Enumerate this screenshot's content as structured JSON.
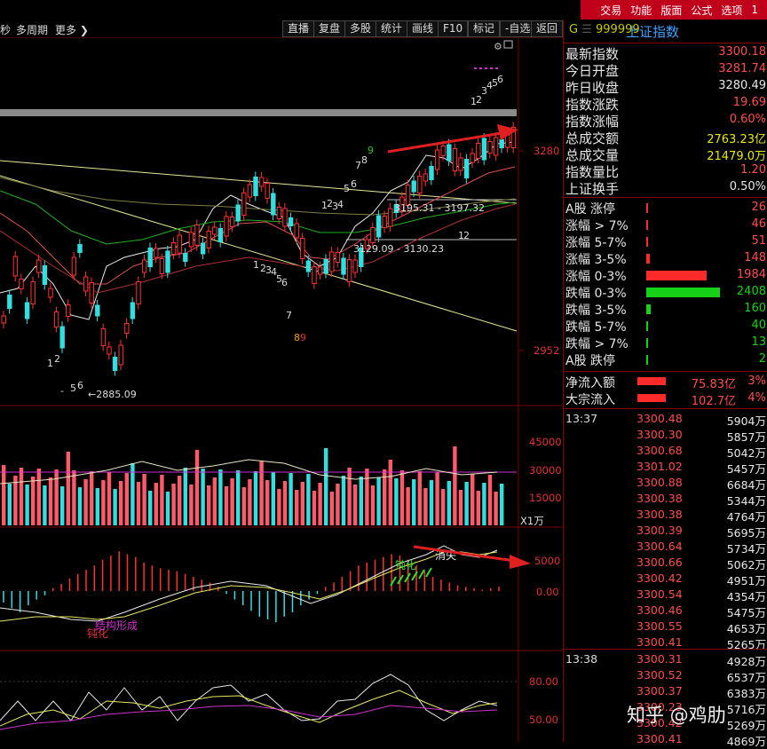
{
  "menu": [
    "交易",
    "功能",
    "版面",
    "公式",
    "选项",
    "1"
  ],
  "toolbar": {
    "left_items": [
      "秒",
      "多周期",
      "更多 ❯"
    ],
    "buttons": [
      "直播",
      "复盘",
      "多股",
      "统计",
      "画线",
      "F10",
      "标记",
      "-自选",
      "返回"
    ]
  },
  "index": {
    "code": "999999",
    "name": "上证指数",
    "prefix": "G"
  },
  "stats": [
    {
      "label": "最新指数",
      "value": "3300.18",
      "color": "#ff4d4d"
    },
    {
      "label": "今日开盘",
      "value": "3281.74",
      "color": "#ff4d4d"
    },
    {
      "label": "昨日收盘",
      "value": "3280.49",
      "color": "#e8e8e8"
    },
    {
      "label": "指数涨跌",
      "value": "19.69",
      "color": "#ff4d4d"
    },
    {
      "label": "指数涨幅",
      "value": "0.60%",
      "color": "#ff4d4d"
    },
    {
      "label": "总成交额",
      "value": "2763.23亿",
      "color": "#e8e800"
    },
    {
      "label": "总成交量",
      "value": "21479.0万",
      "color": "#e8e800"
    },
    {
      "label": "指数量比",
      "value": "1.20",
      "color": "#ff4d4d"
    },
    {
      "label": "上证换手",
      "value": "0.50%",
      "color": "#e8e8e8"
    }
  ],
  "breadth": [
    {
      "label": "A股 涨停",
      "value": "26",
      "bar": 0.005,
      "color": "#ff2a2a"
    },
    {
      "label": "涨幅 > 7%",
      "value": "46",
      "bar": 0.01,
      "color": "#ff2a2a"
    },
    {
      "label": "涨幅 5-7%",
      "value": "51",
      "bar": 0.012,
      "color": "#ff2a2a"
    },
    {
      "label": "涨幅 3-5%",
      "value": "148",
      "bar": 0.04,
      "color": "#ff2a2a"
    },
    {
      "label": "涨幅 0-3%",
      "value": "1984",
      "bar": 0.75,
      "color": "#ff2a2a"
    },
    {
      "label": "跌幅 0-3%",
      "value": "2408",
      "bar": 0.92,
      "color": "#16d216"
    },
    {
      "label": "跌幅 3-5%",
      "value": "160",
      "bar": 0.05,
      "color": "#16d216"
    },
    {
      "label": "跌幅 5-7%",
      "value": "40",
      "bar": 0.01,
      "color": "#16d216"
    },
    {
      "label": "跌幅 > 7%",
      "value": "13",
      "bar": 0.005,
      "color": "#16d216"
    },
    {
      "label": "A股 跌停",
      "value": "2",
      "bar": 0.003,
      "color": "#16d216"
    }
  ],
  "flows": [
    {
      "label": "净流入额",
      "amount": "75.83亿",
      "pct": "3%"
    },
    {
      "label": "大宗流入",
      "amount": "102.7亿",
      "pct": "4%"
    }
  ],
  "ticks_1337": {
    "time": "13:37",
    "rows": [
      [
        "3300.48",
        "5904万"
      ],
      [
        "3300.30",
        "5857万"
      ],
      [
        "3300.68",
        "5042万"
      ],
      [
        "3301.02",
        "5457万"
      ],
      [
        "3300.88",
        "6684万"
      ],
      [
        "3300.38",
        "5344万"
      ],
      [
        "3300.38",
        "4764万"
      ],
      [
        "3300.39",
        "5695万"
      ],
      [
        "3300.64",
        "5734万"
      ],
      [
        "3300.66",
        "5062万"
      ],
      [
        "3300.42",
        "4951万"
      ],
      [
        "3300.54",
        "4354万"
      ],
      [
        "3300.46",
        "5475万"
      ],
      [
        "3300.55",
        "4653万"
      ],
      [
        "3300.41",
        "5265万"
      ]
    ]
  },
  "ticks_1338": {
    "time": "13:38",
    "rows": [
      [
        "3300.31",
        "4928万"
      ],
      [
        "3300.52",
        "6537万"
      ],
      [
        "3300.37",
        "6383万"
      ],
      [
        "3300.23",
        "5716万"
      ],
      [
        "3300.42",
        "5269万"
      ],
      [
        "3300.41",
        "4869万"
      ]
    ]
  },
  "chart_labels": {
    "price_axis": [
      "3280",
      "2952"
    ],
    "volume_axis": [
      "45000",
      "30000",
      "15000",
      "X1万"
    ],
    "macd_axis": [
      "5000",
      "0.00"
    ],
    "kdj_axis": [
      "80.00",
      "50.00"
    ],
    "low_mark": "←2885.09",
    "gap_upper": "3195.31 - 3197.32",
    "gap_lower": "3129.09 - 3130.23",
    "macd_dull_green": "钝化",
    "macd_gone": "消失",
    "macd_dull_red": "钝化",
    "macd_structure": "结构形成"
  },
  "watermark": "知乎 @鸡肋"
}
